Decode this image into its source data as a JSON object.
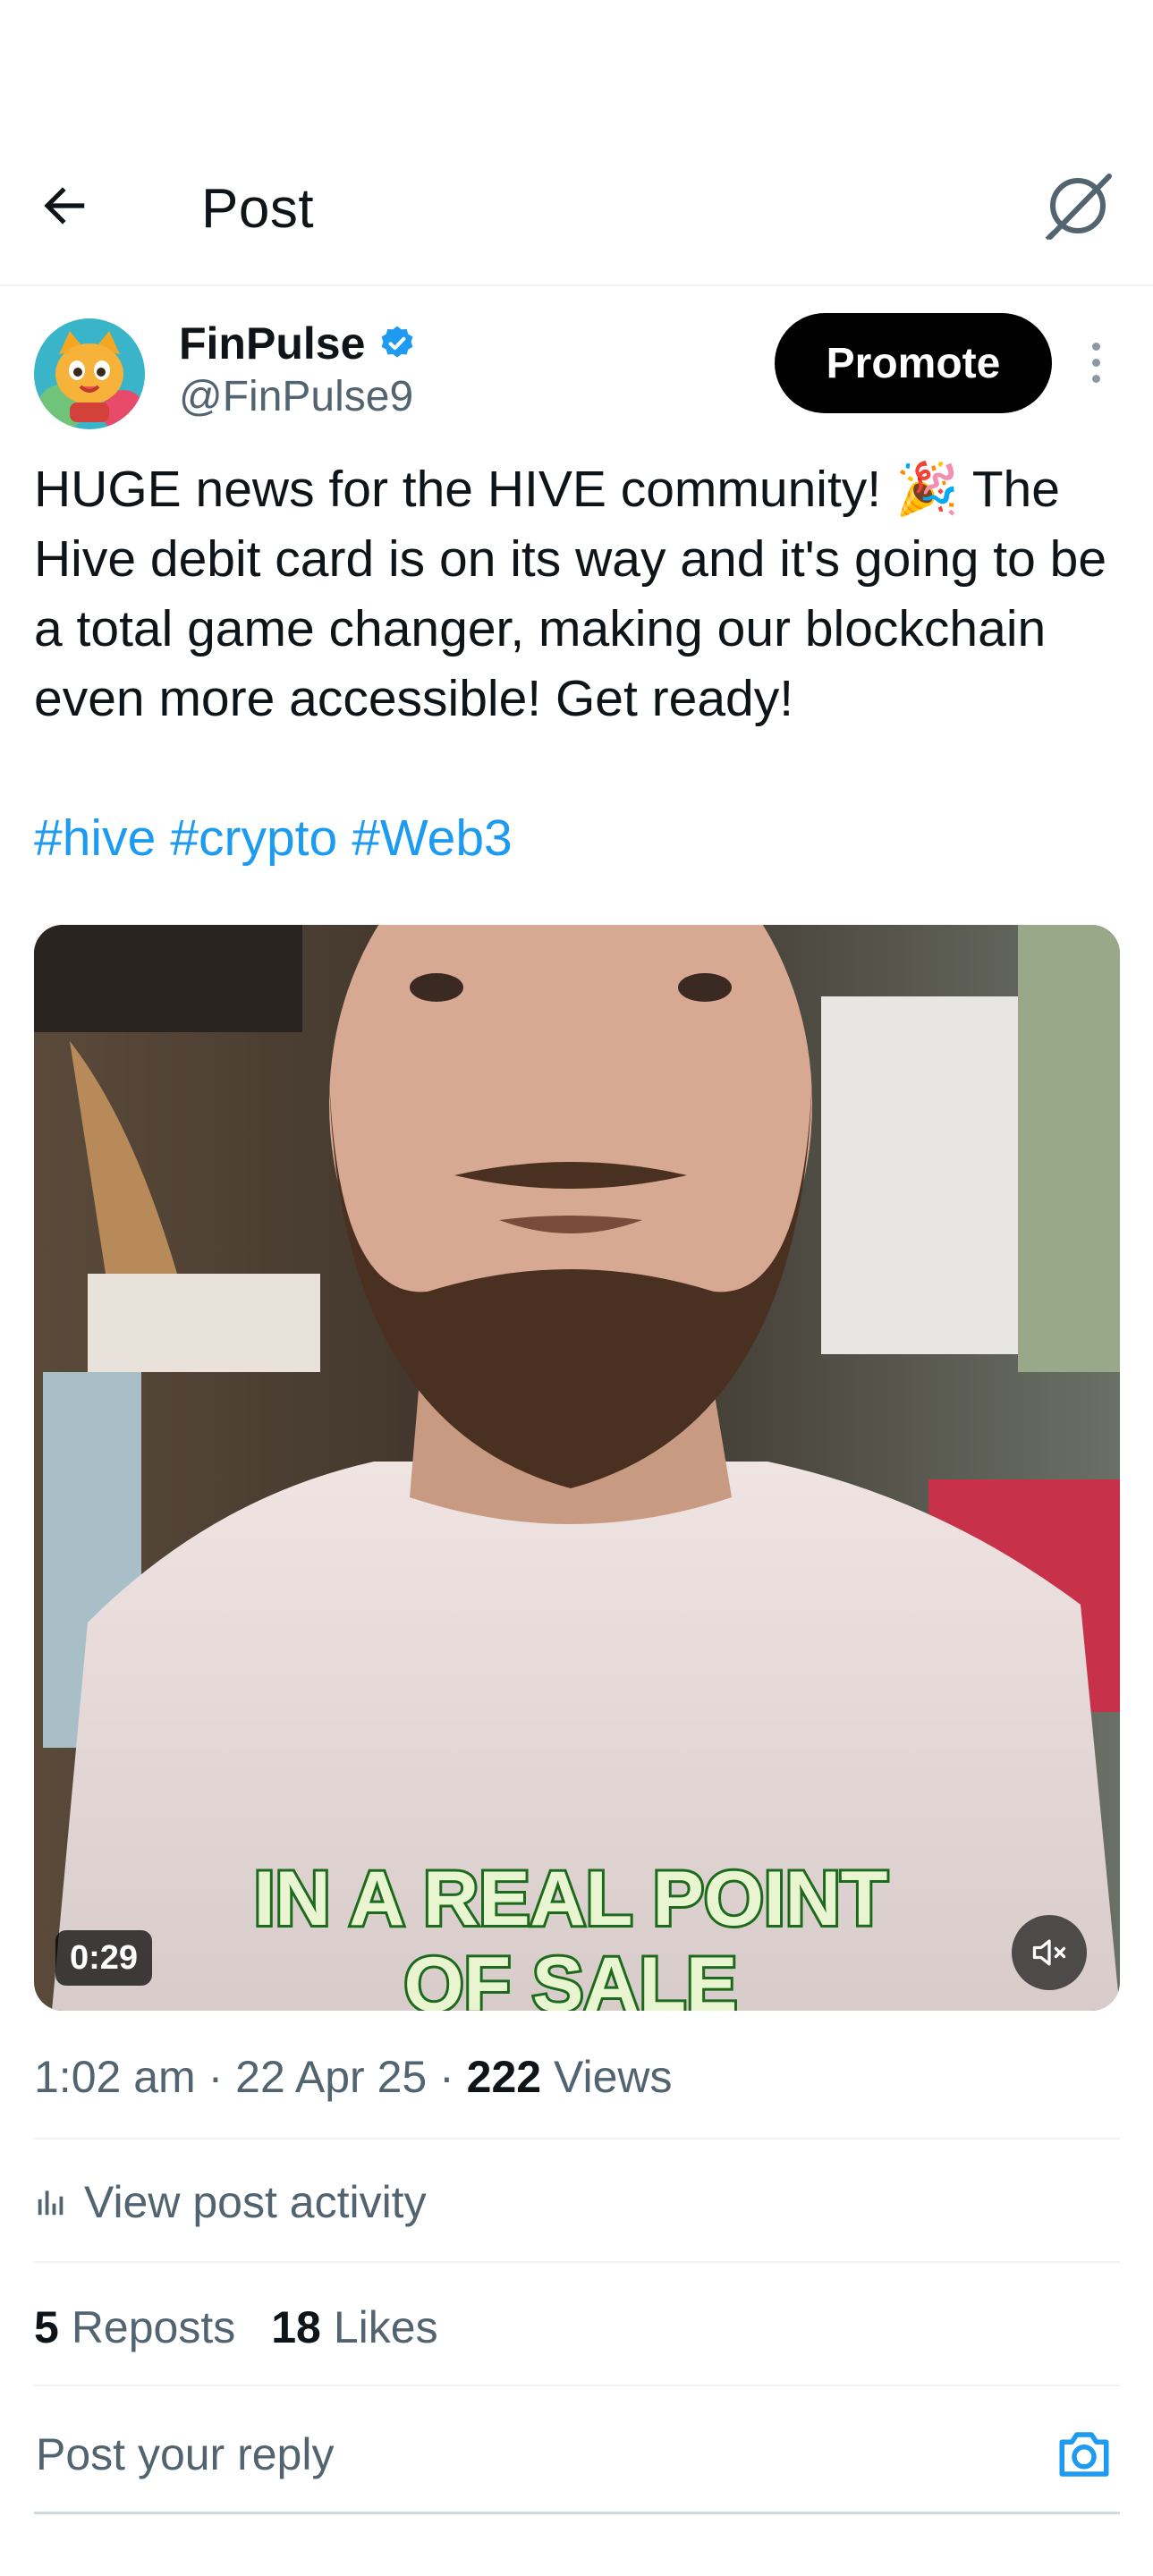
{
  "header": {
    "title": "Post",
    "back_icon": "arrow-left-icon",
    "grok_icon": "grok-icon"
  },
  "post": {
    "author": {
      "name": "FinPulse",
      "handle": "@FinPulse9",
      "verified_icon": "verified-badge-icon",
      "avatar": "cartoon-cat-avatar"
    },
    "promote_label": "Promote",
    "more_icon": "more-vertical-icon",
    "text": "HUGE news for the HIVE community! 🎉 The Hive debit card is on its way and it's going to be a total game changer, making our blockchain even more accessible! Get ready!",
    "hashtags": [
      "#hive",
      "#crypto",
      "#Web3"
    ],
    "video": {
      "duration": "0:29",
      "caption_line1": "IN A REAL POINT",
      "caption_line2": "OF SALE",
      "mute_icon": "volume-muted-icon"
    },
    "meta": {
      "time": "1:02 am",
      "date": "22 Apr 25",
      "views_count": "222",
      "views_label": "Views",
      "separator": "·"
    },
    "activity_label": "View post activity",
    "activity_icon": "analytics-icon",
    "stats": {
      "reposts_count": "5",
      "reposts_label": "Reposts",
      "likes_count": "18",
      "likes_label": "Likes"
    }
  },
  "reply": {
    "placeholder": "Post your reply",
    "camera_icon": "camera-icon"
  },
  "colors": {
    "accent": "#1d9bf0",
    "text": "#0f1419",
    "secondary": "#536471",
    "caption_fill": "#e8f5d0",
    "caption_stroke": "#1c6a1c"
  }
}
